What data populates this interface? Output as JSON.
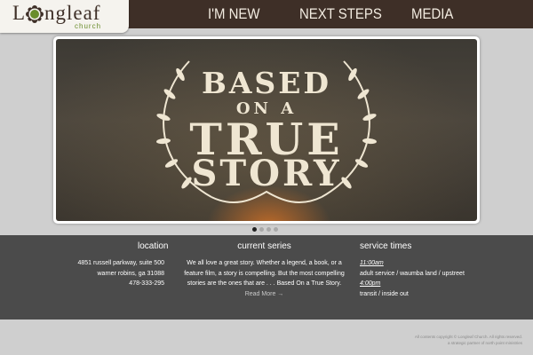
{
  "header": {
    "logo": {
      "l_letter": "L",
      "rest": "ngleaf",
      "sub": "church"
    },
    "nav": [
      "I'M NEW",
      "NEXT STEPS",
      "MEDIA"
    ]
  },
  "slide": {
    "line1": "BASED",
    "line2": "ON A",
    "line3": "TRUE",
    "line4": "STORY"
  },
  "slider_dots": {
    "count": 4,
    "active": 0
  },
  "info": {
    "location": {
      "title": "location",
      "lines": [
        "4851 russell parkway, suite 500",
        "warner robins, ga 31088",
        "478-333-295"
      ]
    },
    "current_series": {
      "title": "current series",
      "text": "We all love a great story. Whether a legend, a book, or a feature film, a story is compelling. But the most compelling stories are the ones that are . . . Based On a True Story.",
      "more": "Read More →"
    },
    "service_times": {
      "title": "service times",
      "time1": "11:00am",
      "desc1": "adult service / waumba land / upstreet",
      "time2": "4:00pm",
      "desc2": "transit / inside out"
    }
  },
  "footer": {
    "line1": "All contents copyright © Longleaf Church. All rights reserved.",
    "line2": "a strategic partner of north point ministries"
  },
  "colors": {
    "header": "#3e2f27",
    "band": "#4b4b4b",
    "footer": "#cfcfcf",
    "logo_green": "#6a8d2c"
  }
}
